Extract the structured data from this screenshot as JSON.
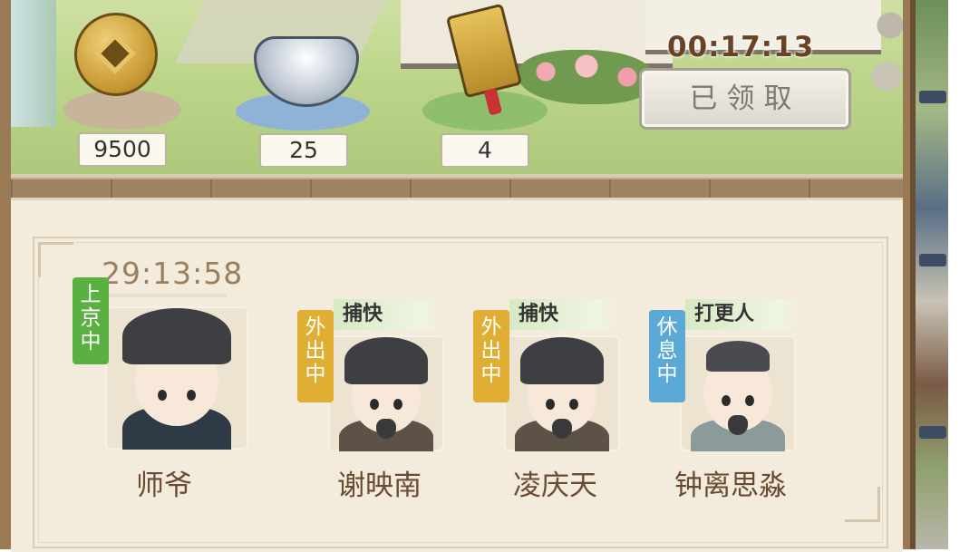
{
  "rewards": [
    {
      "icon": "copper-coin-icon",
      "amount": "9500"
    },
    {
      "icon": "silver-ingot-icon",
      "amount": "25"
    },
    {
      "icon": "token-plaque-icon",
      "amount": "4"
    }
  ],
  "reward_timer": "00:17:13",
  "claim_button_label": "已领取",
  "countdown": "29:13:58",
  "characters": [
    {
      "name": "师爷",
      "status": "上京中",
      "status_color": "#5bb042",
      "job": ""
    },
    {
      "name": "谢映南",
      "status": "外出中",
      "status_color": "#e0ae33",
      "job": "捕快"
    },
    {
      "name": "凌庆天",
      "status": "外出中",
      "status_color": "#e0ae33",
      "job": "捕快"
    },
    {
      "name": "钟离思淼",
      "status": "休息中",
      "status_color": "#5aa9d6",
      "job": "打更人"
    }
  ],
  "colors": {
    "frame": "#9a7a55",
    "panel": "#f3ecdd",
    "name_text": "#6a4a33"
  }
}
